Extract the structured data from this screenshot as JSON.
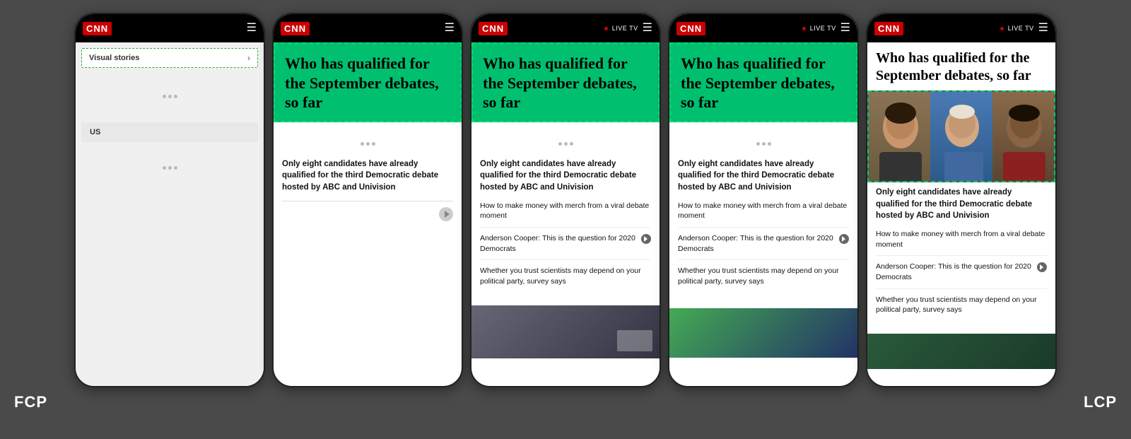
{
  "background_color": "#4a4a4a",
  "phones": [
    {
      "id": "phone1",
      "has_live_tv": false,
      "has_hamburger": true,
      "has_menu_lines": true,
      "visual_stories_label": "Visual stories",
      "chevron": "›",
      "us_label": "US",
      "type": "fcp_empty"
    },
    {
      "id": "phone2",
      "has_live_tv": false,
      "has_hamburger": true,
      "headline": "Who has qualified for the September debates, so far",
      "main_article": "Only eight candidates have already qualified for the third Democratic debate hosted by ABC and Univision",
      "links": [],
      "type": "article_nolinks"
    },
    {
      "id": "phone3",
      "has_live_tv": true,
      "has_hamburger": true,
      "headline": "Who has qualified for the September debates, so far",
      "main_article": "Only eight candidates have already qualified for the third Democratic debate hosted by ABC and Univision",
      "links": [
        "How to make money with merch from a viral debate moment",
        "Anderson Cooper: This is the question for 2020 Democrats",
        "Whether you trust scientists may depend on your political party, survey says"
      ],
      "has_video_thumb": true,
      "type": "article_links_video"
    },
    {
      "id": "phone4",
      "has_live_tv": true,
      "has_hamburger": true,
      "headline": "Who has qualified for the September debates, so far",
      "main_article": "Only eight candidates have already qualified for the third Democratic debate hosted by ABC and Univision",
      "links": [
        "How to make money with merch from a viral debate moment",
        "Anderson Cooper: This is the question for 2020 Democrats",
        "Whether you trust scientists may depend on your political party, survey says"
      ],
      "has_video_thumb": true,
      "has_bottom_image": true,
      "type": "article_links_image"
    },
    {
      "id": "phone5",
      "has_live_tv": true,
      "has_hamburger": true,
      "headline": "Who has qualified for the September debates, so far",
      "main_article": "Only eight candidates have already qualified for the third Democratic debate hosted by ABC and Univision",
      "links": [
        "How to make money with merch from a viral debate moment",
        "Anderson Cooper: This is the question for 2020 Democrats",
        "Whether you trust scientists may depend on your political party, survey says"
      ],
      "has_faces": true,
      "has_bottom_image": true,
      "type": "article_faces_lcp"
    }
  ],
  "labels": {
    "fcp": "FCP",
    "lcp": "LCP"
  },
  "cnn_logo": "CNN",
  "live_tv_text": "LIVE TV"
}
